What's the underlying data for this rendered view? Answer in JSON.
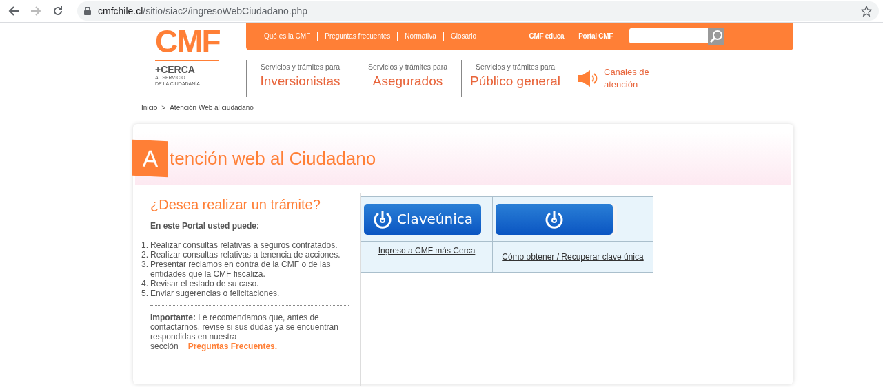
{
  "browser": {
    "url_domain": "cmfchile.cl",
    "url_path": "/sitio/siac2/ingresoWebCiudadano.php"
  },
  "logo": {
    "mark": "CMF",
    "tagline": "+CERCA",
    "sub_lines": [
      "AL SERVICIO",
      "DE LA CIUDADANÍA"
    ]
  },
  "top_links": [
    "Qué es la CMF",
    "Preguntas frecuentes",
    "Normativa",
    "Glosario"
  ],
  "top_links_right": [
    "CMF educa",
    "Portal CMF"
  ],
  "services": [
    {
      "caption": "Servicios y trámites para",
      "title": "Inversionistas"
    },
    {
      "caption": "Servicios y trámites para",
      "title": "Asegurados"
    },
    {
      "caption": "Servicios y trámites para",
      "title": "Público general"
    }
  ],
  "channels": {
    "label": "Canales de atención"
  },
  "breadcrumb": [
    {
      "label": "Inicio"
    },
    {
      "label": ">"
    },
    {
      "label": "Atención Web al ciudadano"
    }
  ],
  "page_title": {
    "initial": "A",
    "rest": "tención web al Ciudadano"
  },
  "intro": {
    "heading": "¿Desea realizar un trámite?",
    "subheading": "En este Portal usted puede:",
    "items": [
      {
        "number": "1.",
        "text": "Realizar consultas relativas a seguros contratados."
      },
      {
        "number": "2.",
        "text": "Realizar consultas relativas a tenencia de acciones."
      },
      {
        "number": "3.",
        "text": "Presentar reclamos en contra de la CMF o de las entidades que la CMF fiscaliza."
      },
      {
        "number": "4.",
        "text": "Revisar el estado de su caso."
      },
      {
        "number": "5.",
        "text": "Enviar sugerencias o felicitaciones."
      }
    ],
    "note": "**Importante:** Le recomendamos que, antes de contactarnos, revise si sus dudas ya se encuentran respondidas en nuestra sección",
    "note_link": "Preguntas Frecuentes."
  },
  "login": [
    {
      "button_label": "Claveúnica",
      "link": "Ingreso a CMF más Cerca"
    },
    {
      "link": "Cómo obtener / Recuperar clave única"
    }
  ]
}
